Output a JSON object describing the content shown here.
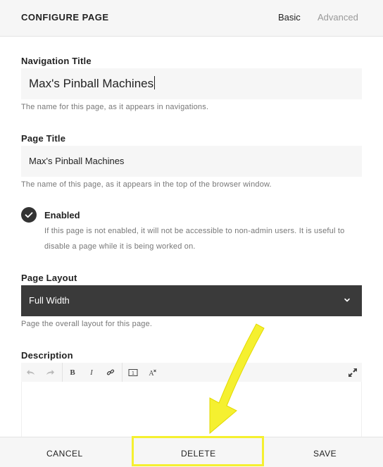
{
  "header": {
    "title": "CONFIGURE PAGE",
    "tabs": [
      "Basic",
      "Advanced"
    ]
  },
  "navigation_title": {
    "label": "Navigation Title",
    "value": "Max's Pinball Machines",
    "help": "The name for this page, as it appears in navigations."
  },
  "page_title": {
    "label": "Page Title",
    "value": "Max's Pinball Machines",
    "help": "The name of this page, as it appears in the top of the browser window."
  },
  "enabled": {
    "label": "Enabled",
    "checked": true,
    "help": "If this page is not enabled, it will not be accessible to non-admin users. It is useful to disable a page while it is being worked on."
  },
  "page_layout": {
    "label": "Page Layout",
    "selected": "Full Width",
    "help": "Page the overall layout for this page."
  },
  "description": {
    "label": "Description",
    "toolbar": [
      "undo-icon",
      "redo-icon",
      "bold-icon",
      "italic-icon",
      "link-icon",
      "insert-block-icon",
      "clear-format-icon",
      "expand-icon"
    ],
    "toolbar_glyphs": {
      "bold": "B",
      "italic": "I",
      "insert": "1",
      "clear": "A"
    },
    "value": ""
  },
  "footer": {
    "cancel": "CANCEL",
    "delete": "DELETE",
    "save": "SAVE"
  },
  "annotation": {
    "highlight_color": "#f5f030",
    "arrow_color": "#f5f030",
    "arrow_target": "delete-button"
  },
  "colors": {
    "select_bg": "#3a3a3a",
    "field_bg": "#f6f6f6",
    "help_text": "#777777"
  }
}
